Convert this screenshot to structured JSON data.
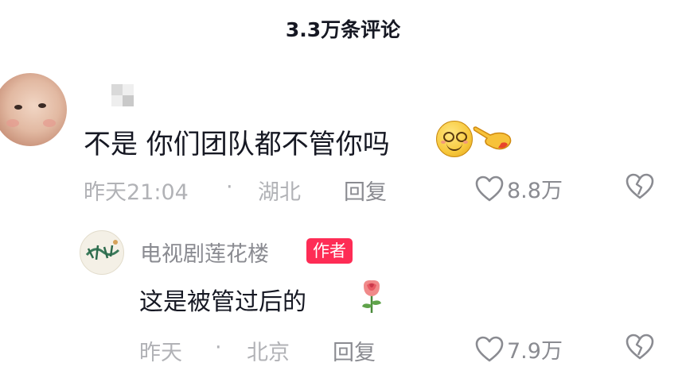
{
  "header": {
    "title": "3.3万条评论"
  },
  "comment": {
    "text": "不是 你们团队都不管你吗",
    "time": "昨天21:04",
    "dot": "·",
    "location": "湖北",
    "reply_label": "回复",
    "likes": "8.8万",
    "emojis": [
      "smile-icon",
      "pointing-hand-icon"
    ]
  },
  "reply": {
    "user_name": "电视剧莲花楼",
    "badge": "作者",
    "text": "这是被管过后的",
    "time": "昨天",
    "dot": "·",
    "location": "北京",
    "reply_label": "回复",
    "likes": "7.9万",
    "emojis": [
      "rose-icon"
    ]
  },
  "colors": {
    "text_primary": "#161823",
    "text_secondary": "#8a8b91",
    "text_meta": "#b1b2b6",
    "badge_bg": "#fe2c55",
    "badge_text": "#ffffff"
  }
}
